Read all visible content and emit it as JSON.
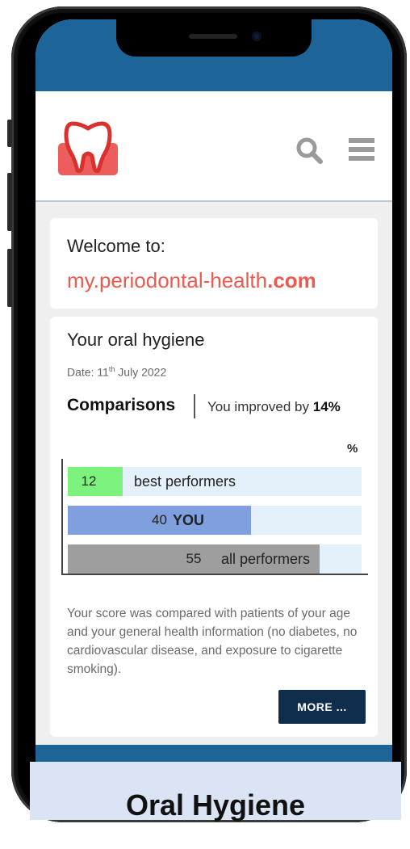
{
  "header": {
    "logo_icon": "tooth-icon",
    "search_icon": "search-icon",
    "menu_icon": "menu-icon"
  },
  "welcome": {
    "greeting": "Welcome to:",
    "site_name": "my.periodontal-health",
    "site_tld": ".com"
  },
  "report": {
    "title": "Your oral hygiene",
    "date_prefix": "Date: 11",
    "date_suffix_sup": "th",
    "date_rest": " July 2022",
    "comparisons_label": "Comparisons",
    "improved_text": "You improved by ",
    "improved_value": "14%",
    "unit_label": "%",
    "description": "Your score was compared with patients of your age and your general health information (no diabetes, no cardiovascular disease, and exposure to cigarette smoking).",
    "more_label": "MORE ..."
  },
  "chart_data": {
    "type": "bar",
    "orientation": "horizontal",
    "categories": [
      "best performers",
      "YOU",
      "all performers"
    ],
    "values": [
      12,
      40,
      55
    ],
    "value_labels": [
      "12",
      "40",
      "55"
    ],
    "colors": [
      "#7cf37c",
      "#7f9fde",
      "#9e9e9e"
    ],
    "xlim": [
      0,
      100
    ]
  },
  "caption": "Oral Hygiene",
  "colors": {
    "brand_blue": "#1d6498",
    "accent_red": "#ea5a4e",
    "button_navy": "#0f2d4d"
  }
}
